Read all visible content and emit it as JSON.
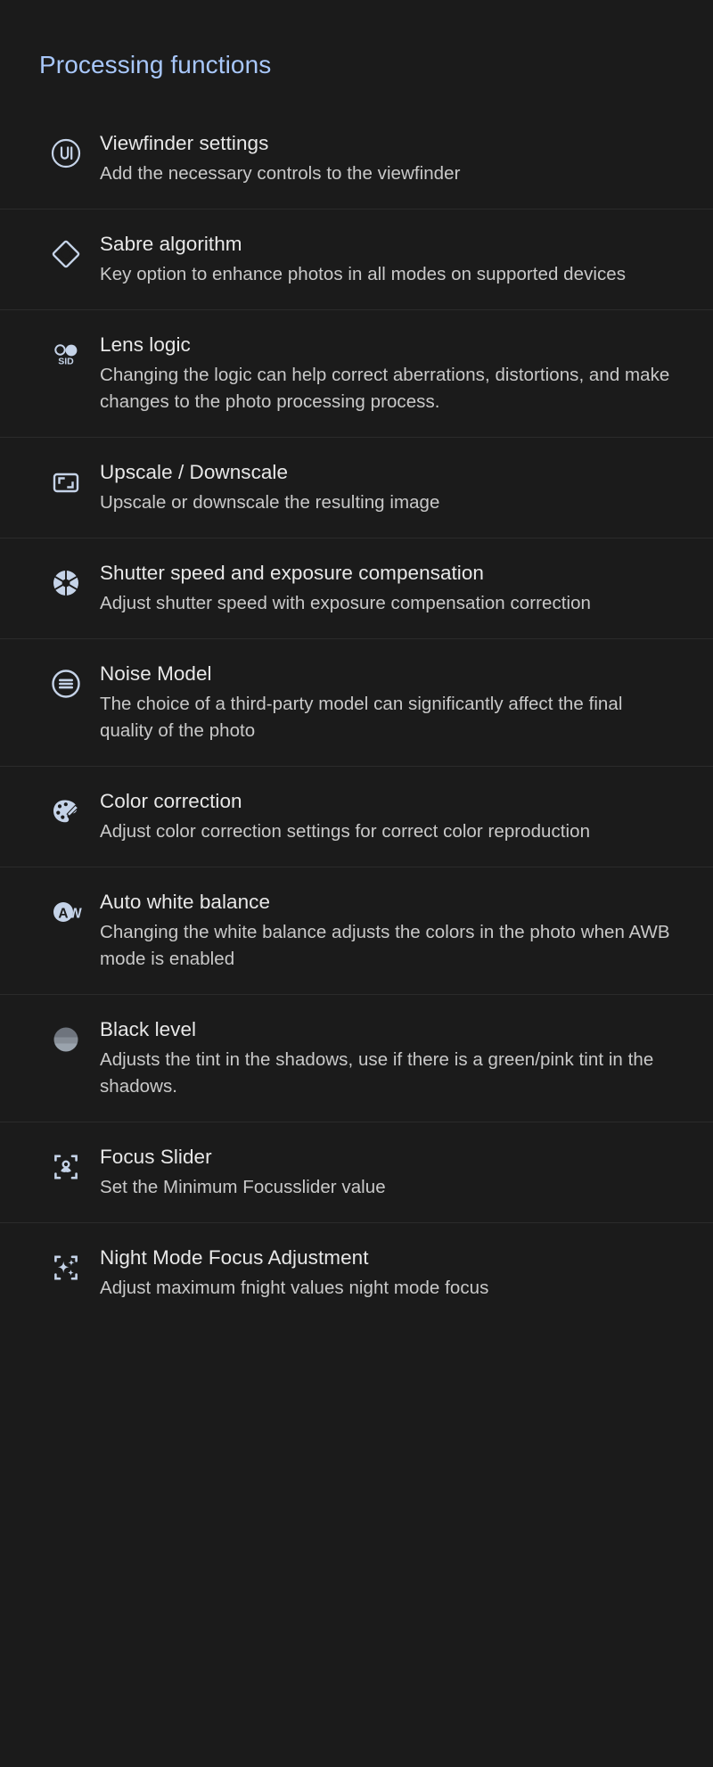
{
  "header": {
    "title": "Processing functions",
    "accent_color": "#a8c7fa"
  },
  "colors": {
    "background": "#1b1b1b",
    "divider": "#2b2b2b",
    "title_text": "#e8e8e8",
    "description_text": "#c9c9c9",
    "icon": "#c5d3e8"
  },
  "items": [
    {
      "icon": "ui-circle-icon",
      "title": "Viewfinder settings",
      "description": "Add the necessary controls to the viewfinder"
    },
    {
      "icon": "diamond-icon",
      "title": "Sabre algorithm",
      "description": "Key option to enhance photos in all modes on supported devices"
    },
    {
      "icon": "sid-lens-icon",
      "title": "Lens logic",
      "description": "Changing the logic can help correct aberrations, distortions, and make changes to the photo processing process."
    },
    {
      "icon": "resize-frame-icon",
      "title": "Upscale / Downscale",
      "description": "Upscale or downscale the resulting image"
    },
    {
      "icon": "aperture-icon",
      "title": "Shutter speed and exposure compensation",
      "description": "Adjust shutter speed with exposure compensation correction"
    },
    {
      "icon": "noise-lines-circle-icon",
      "title": "Noise Model",
      "description": "The choice of a third-party model can significantly affect the final quality of the photo"
    },
    {
      "icon": "color-palette-icon",
      "title": "Color correction",
      "description": "Adjust color correction settings for correct color reproduction"
    },
    {
      "icon": "awb-icon",
      "title": "Auto white balance",
      "description": "Changing the white balance adjusts the colors in the photo when AWB mode is enabled"
    },
    {
      "icon": "black-level-circle-icon",
      "title": "Black level",
      "description": "Adjusts the tint in the shadows, use if there is a green/pink tint in the shadows."
    },
    {
      "icon": "center-focus-macro-icon",
      "title": "Focus Slider",
      "description": "Set the Minimum Focusslider value"
    },
    {
      "icon": "night-focus-sparkle-icon",
      "title": "Night Mode Focus Adjustment",
      "description": "Adjust maximum fnight values night mode focus"
    }
  ]
}
